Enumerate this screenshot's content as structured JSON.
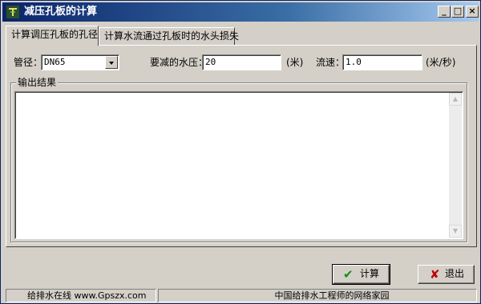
{
  "window": {
    "title": "减压孔板的计算",
    "controls": {
      "minimize": "_",
      "maximize": "□",
      "close": "×"
    }
  },
  "tabs": [
    {
      "label": "计算调压孔板的孔径",
      "active": true
    },
    {
      "label": "计算水流通过孔板时的水头损失",
      "active": false
    }
  ],
  "form": {
    "pipe_diameter": {
      "label": "管径：",
      "value": "DN65"
    },
    "pressure_reduction": {
      "label": "要减的水压：",
      "value": "20",
      "unit": "(米)"
    },
    "flow_velocity": {
      "label": "流速：",
      "value": "1.0",
      "unit": "(米/秒)"
    }
  },
  "output": {
    "legend": "输出结果",
    "text": ""
  },
  "buttons": {
    "calculate": {
      "label": "计算",
      "icon": "check-icon"
    },
    "exit": {
      "label": "退出",
      "icon": "x-icon"
    }
  },
  "statusbar": {
    "left": "给排水在线 www.Gpszx.com",
    "right": "中国给排水工程师的网络家园"
  },
  "colors": {
    "title_gradient_start": "#0a246a",
    "title_gradient_end": "#a6caf0",
    "face": "#d4d0c8",
    "check": "#1a8a1a",
    "x_mark": "#c00000"
  }
}
